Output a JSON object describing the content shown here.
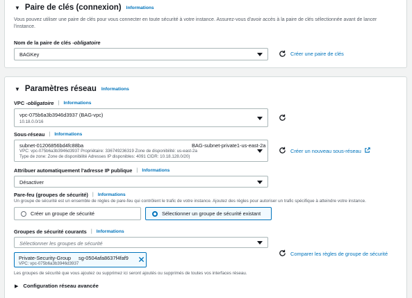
{
  "keypair": {
    "title": "Paire de clés (connexion)",
    "info": "Informations",
    "description": "Vous pouvez utiliser une paire de clés pour vous connecter en toute sécurité à votre instance. Assurez-vous d'avoir accès à la paire de clés sélectionnée avant de lancer l'instance.",
    "name_label": "Nom de la paire de clés - ",
    "name_required": "obligatoire",
    "selected": "BAGKey",
    "create_link": "Créer une paire de clés"
  },
  "network": {
    "title": "Paramètres réseau",
    "info": "Informations",
    "vpc": {
      "label": "VPC - ",
      "required": "obligatoire",
      "info": "Informations",
      "value": "vpc-075b6a3b3946d3937 (BAG-vpc)",
      "cidr": "10.18.0.0/16"
    },
    "subnet": {
      "label": "Sous-réseau",
      "info": "Informations",
      "id": "subnet-01206856bd4fc88ba",
      "name": "BAG-subnet-private1-us-east-2a",
      "line2": "VPC: vpc-075b6a3b3946d3937    Propriétaire: 336749236319    Zone de disponibilité: us-east-2a",
      "line3": "Type de zone: Zone de disponibilité    Adresses IP disponibles: 4091    CIDR: 10.18.128.0/20)",
      "create_link": "Créer un nouveau sous-réseau"
    },
    "public_ip": {
      "label": "Attribuer automatiquement l'adresse IP publique",
      "info": "Informations",
      "value": "Désactiver"
    },
    "firewall": {
      "label": "Pare-feu (groupes de sécurité)",
      "info": "Informations",
      "description": "Un groupe de sécurité est un ensemble de règles de pare-feu qui contrôlent le trafic de votre instance. Ajoutez des règles pour autoriser un trafic spécifique à atteindre votre instance.",
      "option_create": "Créer un groupe de sécurité",
      "option_existing": "Sélectionner un groupe de sécurité existant"
    },
    "groups": {
      "label": "Groupes de sécurité courants",
      "info": "Informations",
      "placeholder": "Sélectionner les groupes de sécurité",
      "compare_link": "Comparer les règles de groupe de sécurité",
      "token_name": "Private-Security-Group",
      "token_id": "sg-0504afa8637f4faf9",
      "token_vpc": "VPC: vpc-075b6a3b3946d3937",
      "note": "Les groupes de sécurité que vous ajoutez ou supprimez ici seront ajoutés ou supprimés de toutes vos interfaces réseau."
    },
    "advanced": "Configuration réseau avancée"
  },
  "colors": {
    "link": "#0073bb",
    "text": "#16191f",
    "muted": "#545b64",
    "border": "#aab7b8"
  },
  "icons": {
    "section_toggle": "caret-down-icon",
    "dropdown": "caret-down-icon",
    "refresh": "refresh-icon",
    "external": "external-link-icon",
    "remove": "close-icon",
    "advanced_toggle": "caret-right-icon"
  }
}
